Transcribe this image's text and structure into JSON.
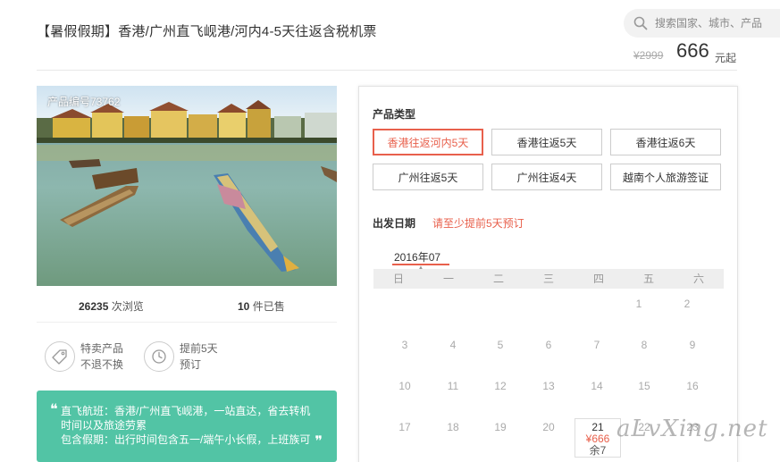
{
  "header": {
    "title": "【暑假假期】香港/广州直飞岘港/河内4-5天往返含税机票",
    "search_placeholder": "搜索国家、城市、产品",
    "old_price": "¥2999",
    "price": "666",
    "price_unit": "元起"
  },
  "product": {
    "product_no": "产品编号73762",
    "views_num": "26235",
    "views_label": "次浏览",
    "sold_num": "10",
    "sold_label": "件已售",
    "features": [
      {
        "line1": "特卖产品",
        "line2": "不退不换",
        "icon": "tag-icon"
      },
      {
        "line1": "提前5天",
        "line2": "预订",
        "icon": "clock-icon"
      }
    ],
    "notice_line1": "直飞航班：香港/广州直飞岘港，一站直达，省去转机",
    "notice_line2": "时间以及旅途劳累",
    "notice_line3": "包含假期：出行时间包含五一/端午小长假，上班族可",
    "quote_open": "❝",
    "quote_close": "❞"
  },
  "options": {
    "type_title": "产品类型",
    "items": [
      {
        "label": "香港往返河内5天",
        "active": true
      },
      {
        "label": "香港往返5天",
        "active": false
      },
      {
        "label": "香港往返6天",
        "active": false
      },
      {
        "label": "广州往返5天",
        "active": false
      },
      {
        "label": "广州往返4天",
        "active": false
      },
      {
        "label": "越南个人旅游签证",
        "active": false
      }
    ],
    "date_title": "出发日期",
    "date_hint": "请至少提前5天预订"
  },
  "calendar": {
    "month": "2016年07",
    "weekdays": [
      "日",
      "一",
      "二",
      "三",
      "四",
      "五",
      "六"
    ],
    "rows": [
      [
        "",
        "",
        "",
        "",
        "",
        "1",
        "2"
      ],
      [
        "3",
        "4",
        "5",
        "6",
        "7",
        "8",
        "9"
      ],
      [
        "10",
        "11",
        "12",
        "13",
        "14",
        "15",
        "16"
      ],
      [
        "17",
        "18",
        "19",
        "20",
        "21",
        "22",
        "23"
      ]
    ],
    "highlight": {
      "day": "21",
      "price": "¥666",
      "remain": "余7"
    }
  },
  "watermark": "aLvXing.net",
  "colors": {
    "accent": "#e8604c",
    "notice_bg": "#52c4a5"
  }
}
